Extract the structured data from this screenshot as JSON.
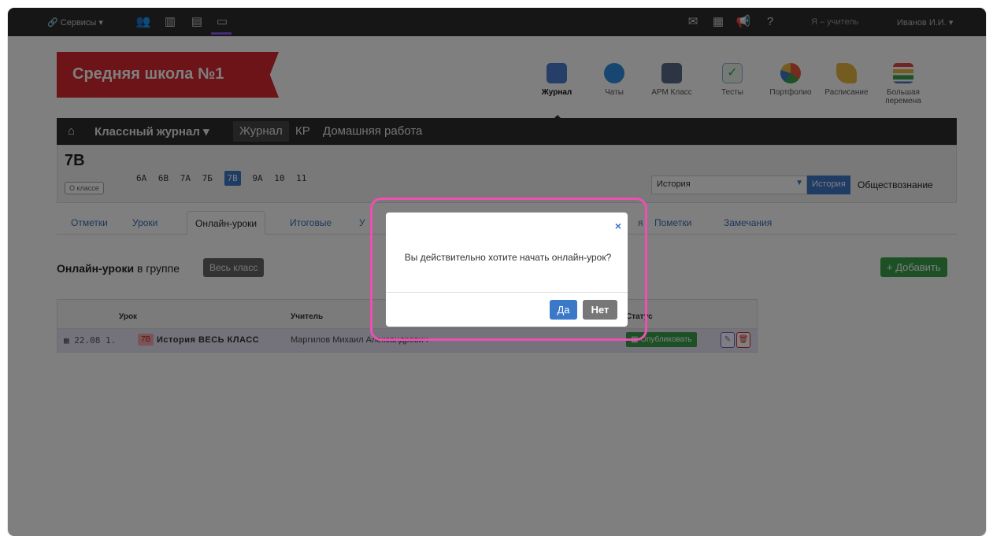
{
  "topbar": {
    "services_label": "Сервисы",
    "role_label": "Я – учитель",
    "user_label": "Иванов И.И."
  },
  "header": {
    "school_name": "Средняя школа №1",
    "apps": [
      {
        "label": "Журнал",
        "icon": "journal-icon",
        "color": "#4a7fd0"
      },
      {
        "label": "Чаты",
        "icon": "chat-icon",
        "color": "#2f8fe0"
      },
      {
        "label": "АРМ Класс",
        "icon": "class-icon",
        "color": "#5b6a8a"
      },
      {
        "label": "Тесты",
        "icon": "tests-icon",
        "color": "#37a64a"
      },
      {
        "label": "Портфолио",
        "icon": "portfolio-icon",
        "color": "#e45b3a"
      },
      {
        "label": "Расписание",
        "icon": "schedule-icon",
        "color": "#e8b640"
      },
      {
        "label": "Большая перемена",
        "icon": "break-icon",
        "color": "#e24a4a"
      }
    ]
  },
  "nav": {
    "home_icon": "home-icon",
    "class_journal": "Классный журнал",
    "journal": "Журнал",
    "kr": "КР",
    "homework": "Домашняя работа"
  },
  "classbar": {
    "current_class": "7В",
    "about_label": "О классе",
    "classes": [
      "6А",
      "6В",
      "7А",
      "7Б",
      "7В",
      "9А",
      "10",
      "11"
    ],
    "selected_class": "7В",
    "subject_select_value": "История",
    "subject_active": "История",
    "subject_other": "Обществознание"
  },
  "tabs": [
    "Отметки",
    "Уроки",
    "Онлайн-уроки",
    "Итоговые",
    "У",
    "я",
    "Пометки",
    "Замечания"
  ],
  "section": {
    "title_bold": "Онлайн-уроки",
    "title_rest": " в группе",
    "group_label": "Весь класс",
    "add_label": "+ Добавить"
  },
  "table": {
    "headers": {
      "lesson": "Урок",
      "teacher": "Учитель",
      "status": "Статус"
    },
    "row": {
      "date": "22.08",
      "number": "1.",
      "class": "7В",
      "lesson": "История ВЕСЬ КЛАСС",
      "teacher": "Маргилов Михаил Александрович",
      "publish": "Опубликовать"
    }
  },
  "modal": {
    "message": "Вы действительно хотите начать онлайн-урок?",
    "yes": "Да",
    "no": "Нет"
  },
  "colors": {
    "brand_red": "#d8282e",
    "primary_blue": "#3c78c8",
    "success_green": "#3aa34a",
    "highlight_pink": "#ee4fb0"
  }
}
